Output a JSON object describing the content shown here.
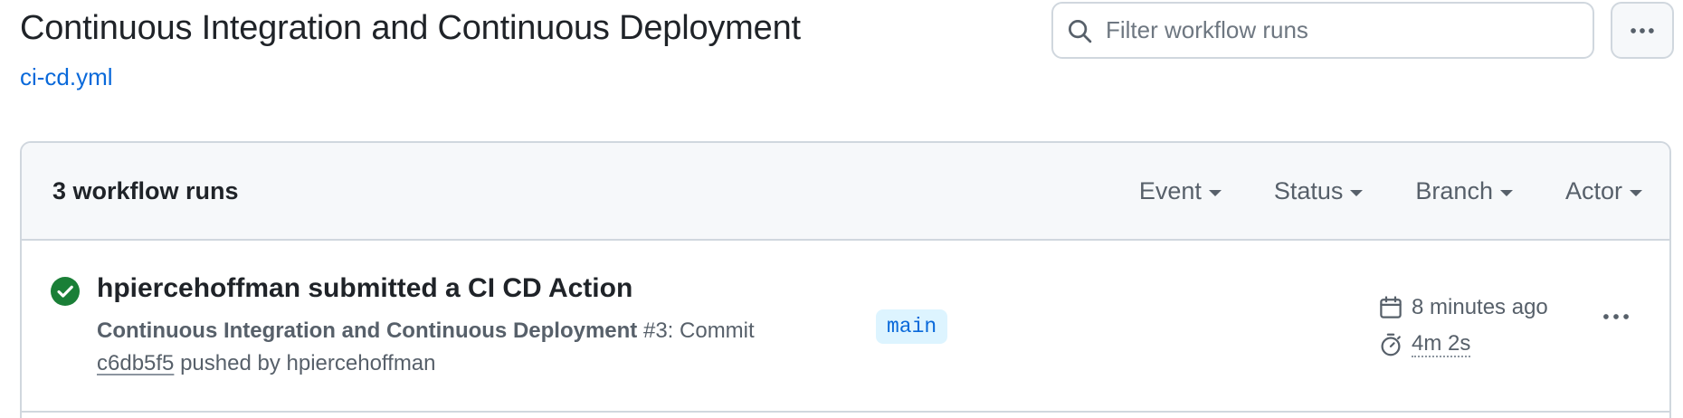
{
  "header": {
    "title": "Continuous Integration and Continuous Deployment",
    "file_link": "ci-cd.yml",
    "search_placeholder": "Filter workflow runs",
    "more_icon": "kebab-horizontal-icon"
  },
  "runs_panel": {
    "count_label": "3 workflow runs",
    "filters": [
      "Event",
      "Status",
      "Branch",
      "Actor"
    ]
  },
  "runs": [
    {
      "status": "success",
      "status_color": "#1a7f37",
      "title": "hpiercehoffman submitted a CI CD Action",
      "workflow_name": "Continuous Integration and Continuous Deployment",
      "run_number": "#3",
      "commit_label": ": Commit",
      "commit_sha": "c6db5f5",
      "pushed_by": "pushed by hpiercehoffman",
      "branch": "main",
      "time_ago": "8 minutes ago",
      "duration": "4m 2s"
    }
  ],
  "colors": {
    "link": "#0969da",
    "border": "#d0d7de",
    "muted": "#57606a",
    "header_bg": "#f6f8fa",
    "branch_bg": "#ddf4ff",
    "success": "#1a7f37"
  }
}
